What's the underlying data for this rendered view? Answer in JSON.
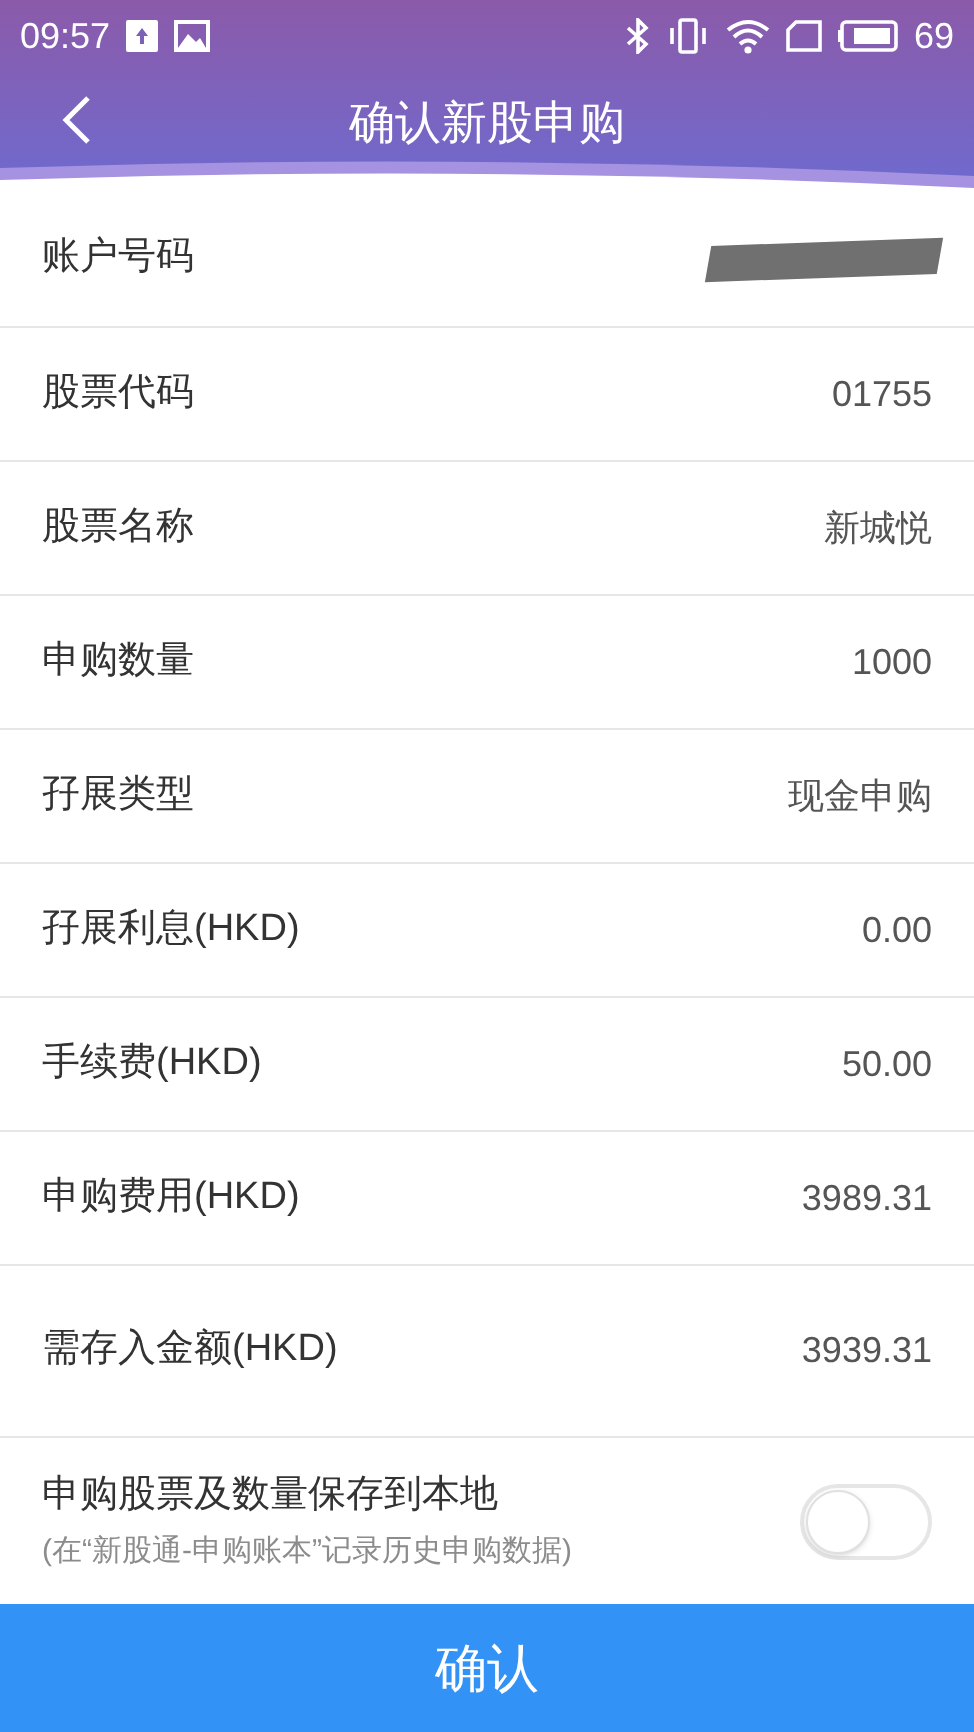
{
  "status_bar": {
    "time": "09:57",
    "battery_text": "69"
  },
  "header": {
    "title": "确认新股申购"
  },
  "rows": [
    {
      "label": "账户号码",
      "kind": "redacted"
    },
    {
      "label": "股票代码",
      "value": "01755",
      "kind": "text"
    },
    {
      "label": "股票名称",
      "value": "新城悦",
      "kind": "text"
    },
    {
      "label": "申购数量",
      "value": "1000",
      "kind": "text"
    },
    {
      "label": "孖展类型",
      "value": "现金申购",
      "kind": "text"
    },
    {
      "label": "孖展利息(HKD)",
      "value": "0.00",
      "kind": "text"
    },
    {
      "label": "手续费(HKD)",
      "value": "50.00",
      "kind": "text"
    },
    {
      "label": "申购费用(HKD)",
      "value": "3989.31",
      "kind": "text"
    },
    {
      "label": "需存入金额(HKD)",
      "value": "3939.31",
      "kind": "text"
    }
  ],
  "save_option": {
    "label": "申购股票及数量保存到本地",
    "note": "(在“新股通-申购账本”记录历史申购数据)",
    "on": false
  },
  "confirm_button": "确认"
}
